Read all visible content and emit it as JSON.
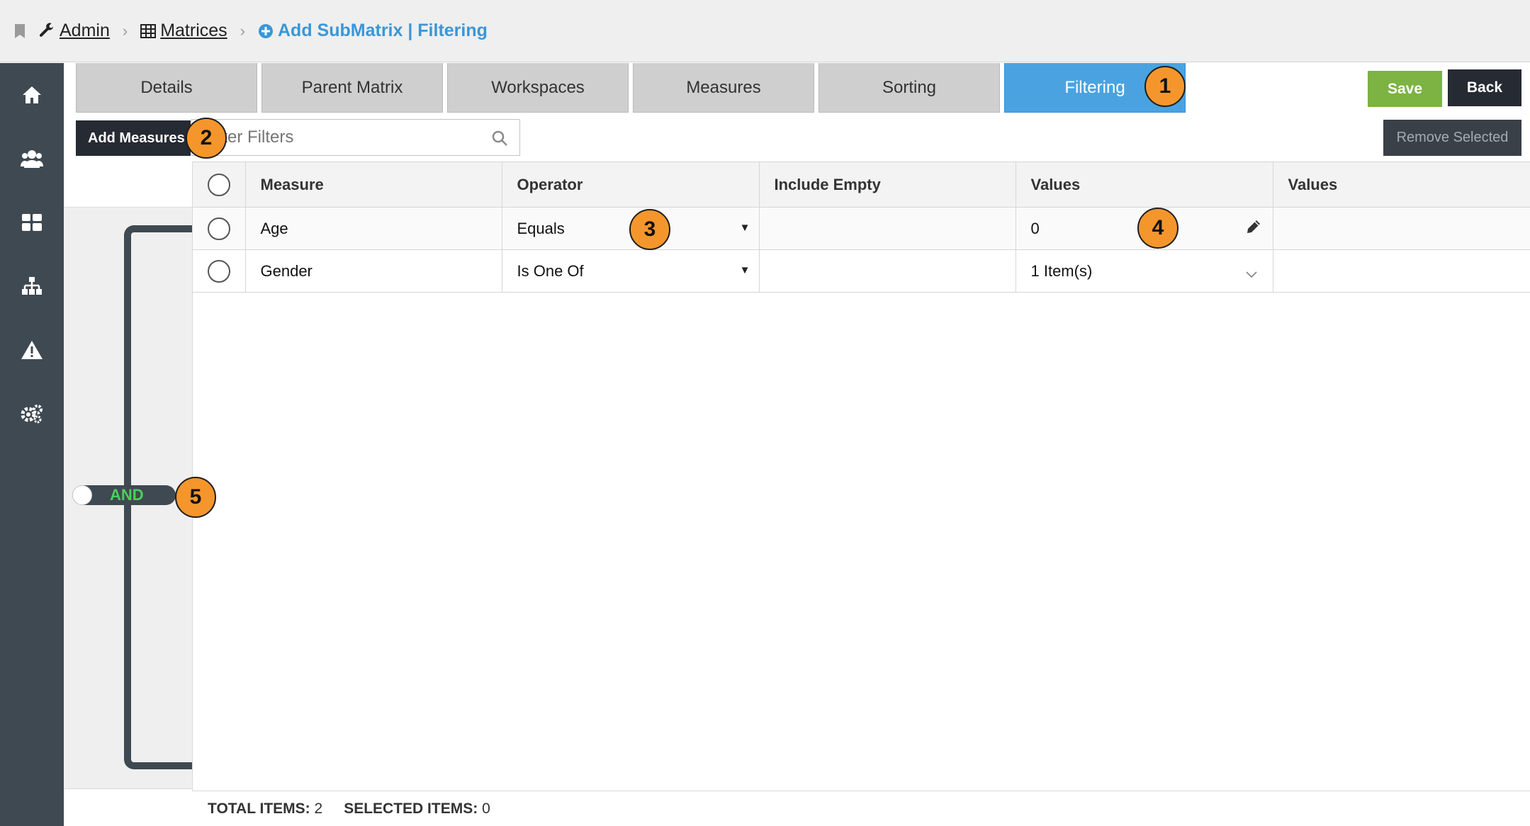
{
  "breadcrumb": {
    "items": [
      {
        "label": "Admin",
        "icon": "wrench-icon"
      },
      {
        "label": "Matrices",
        "icon": "table-icon"
      }
    ],
    "current": {
      "label": "Add SubMatrix | Filtering",
      "icon": "plus-circle-icon"
    }
  },
  "sidenav": {
    "items": [
      {
        "name": "home-icon"
      },
      {
        "name": "users-icon"
      },
      {
        "name": "dashboard-icon"
      },
      {
        "name": "hierarchy-icon"
      },
      {
        "name": "warning-icon"
      },
      {
        "name": "settings-icon"
      }
    ]
  },
  "tabs": [
    {
      "label": "Details",
      "active": false
    },
    {
      "label": "Parent Matrix",
      "active": false
    },
    {
      "label": "Workspaces",
      "active": false
    },
    {
      "label": "Measures",
      "active": false
    },
    {
      "label": "Sorting",
      "active": false
    },
    {
      "label": "Filtering",
      "active": true
    }
  ],
  "actions": {
    "save": "Save",
    "back": "Back",
    "add_measures": "Add Measures",
    "remove_selected": "Remove Selected"
  },
  "search": {
    "placeholder": "Filter Filters",
    "value": ""
  },
  "logic": {
    "operator": "AND"
  },
  "table": {
    "headers": [
      "Measure",
      "Operator",
      "Include Empty",
      "Values",
      "Values"
    ],
    "rows": [
      {
        "measure": "Age",
        "operator": "Equals",
        "include_empty": "",
        "value": "0",
        "extra": ""
      },
      {
        "measure": "Gender",
        "operator": "Is One Of",
        "include_empty": "",
        "value": "1 Item(s)",
        "extra": ""
      }
    ]
  },
  "footer": {
    "total_label": "TOTAL ITEMS:",
    "total_value": "2",
    "selected_label": "SELECTED ITEMS:",
    "selected_value": "0"
  },
  "callouts": [
    "1",
    "2",
    "3",
    "4",
    "5"
  ],
  "colors": {
    "active_tab": "#4aa3e0",
    "save": "#7cb342",
    "dark": "#262a33",
    "nav": "#3f4952",
    "callout": "#f5962c",
    "and_text": "#4ccf5a",
    "breadcrumb_active": "#3a97d6"
  }
}
